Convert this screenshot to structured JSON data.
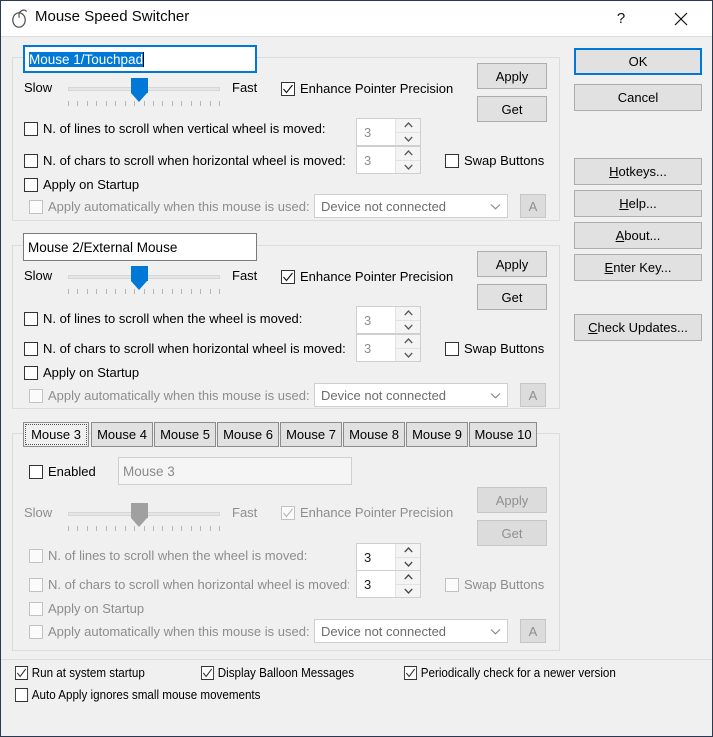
{
  "window": {
    "title": "Mouse Speed Switcher",
    "icon": "mouse-icon",
    "help_button": "?",
    "close_button": "✕",
    "accent_color": "#0078d7"
  },
  "shared": {
    "slow_label": "Slow",
    "fast_label": "Fast",
    "enhance_label": "Enhance Pointer Precision",
    "apply_label": "Apply",
    "get_label": "Get",
    "lines_label_vertical": "N. of lines to scroll when vertical wheel is moved:",
    "lines_label_wheel": "N. of lines to scroll when the wheel is moved:",
    "chars_label": "N. of chars to scroll when  horizontal wheel is moved:",
    "startup_label": "Apply on Startup",
    "auto_label": "Apply automatically when this mouse is used:",
    "swap_label": "Swap Buttons",
    "device_value": "Device not connected",
    "auto_button": "A",
    "spin_value": "3"
  },
  "panel1": {
    "name_value": "Mouse 1/Touchpad",
    "slider_percent": 47,
    "enhance_checked": true,
    "lines_checked": false,
    "chars_checked": false,
    "startup_checked": false,
    "auto_checked": false,
    "swap_checked": false
  },
  "panel2": {
    "name_value": "Mouse 2/External Mouse",
    "slider_percent": 47,
    "enhance_checked": true,
    "lines_checked": false,
    "chars_checked": false,
    "startup_checked": false,
    "auto_checked": false,
    "swap_checked": false
  },
  "panel3": {
    "tabs": [
      "Mouse 3",
      "Mouse 4",
      "Mouse 5",
      "Mouse 6",
      "Mouse 7",
      "Mouse 8",
      "Mouse 9",
      "Mouse 10"
    ],
    "active_tab": "Mouse 3",
    "enabled_label": "Enabled",
    "enabled_checked": false,
    "name_value": "Mouse 3",
    "slider_percent": 47,
    "enhance_checked": true
  },
  "side_buttons": {
    "ok": "OK",
    "cancel": "Cancel",
    "hotkeys": "Hotkeys...",
    "hotkeys_accel": "H",
    "help": "Help...",
    "help_accel": "H",
    "about": "About...",
    "about_accel": "A",
    "enter_key": "Enter Key...",
    "enter_key_accel": "E",
    "check_updates": "Check Updates...",
    "check_updates_accel": "C"
  },
  "bottom_options": {
    "run_startup": {
      "label": "Run at system startup",
      "checked": true
    },
    "balloon": {
      "label": "Display Balloon Messages",
      "checked": true
    },
    "check_version": {
      "label": "Periodically check for a newer version",
      "checked": true
    },
    "auto_apply": {
      "label": "Auto Apply ignores small mouse movements",
      "checked": false
    }
  }
}
